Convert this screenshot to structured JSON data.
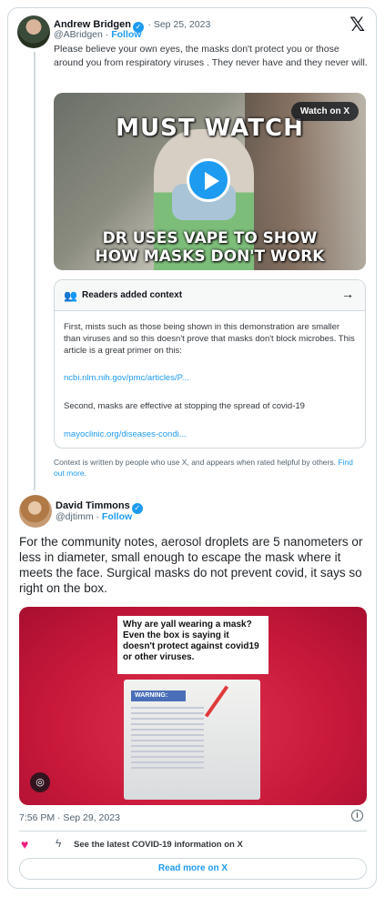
{
  "tweet1": {
    "author_name": "Andrew Bridgen",
    "handle": "@ABridgen",
    "date": "· Sep 25, 2023",
    "separator": "·",
    "follow": "Follow",
    "text": "Please believe your own eyes, the masks don't protect you or those around you from respiratory viruses . They never have and they never will.",
    "video": {
      "overlay_top": "MUST WATCH",
      "overlay_bottom_line1": "DR USES VAPE TO SHOW",
      "overlay_bottom_line2": "HOW MASKS DON'T WORK",
      "watch_label": "Watch on X"
    },
    "context": {
      "title": "Readers added context",
      "paragraph1": "First, mists such as those being shown in this demonstration are smaller than viruses and so this doesn't prove that masks don't block microbes. This article is a great primer on this:",
      "link1": "ncbi.nlm.nih.gov/pmc/articles/P...",
      "paragraph2": "Second, masks are effective at stopping the spread of covid-19",
      "link2": "mayoclinic.org/diseases-condi..."
    },
    "context_note": "Context is written by people who use X, and appears when rated helpful by others.",
    "find_out_more": "Find out more."
  },
  "tweet2": {
    "author_name": "David Timmons",
    "handle": "@djtimm",
    "separator": "·",
    "follow": "Follow",
    "text": "For the community notes, aerosol droplets are 5 nanometers or less in diameter, small enough to escape the mask where it meets the face.  Surgical masks do not prevent covid, it says so right on the box.",
    "image": {
      "caption": "Why are yall wearing a mask? Even the box is saying it doesn't protect against covid19 or other viruses.",
      "box_warning": "WARNING:"
    },
    "timestamp": "7:56 PM · Sep 29, 2023"
  },
  "footer": {
    "covid_info": "See the latest COVID-19 information on X",
    "read_more": "Read more on X"
  },
  "icons": {
    "x_logo": "𝕏",
    "verified": "✓",
    "arrow": "→",
    "info": "i",
    "heart": "♥",
    "bolt": "ϟ",
    "people": "👥",
    "camera": "◎"
  },
  "colors": {
    "accent": "#1d9bf0",
    "heart": "#f91880",
    "border": "#cfd9de"
  }
}
